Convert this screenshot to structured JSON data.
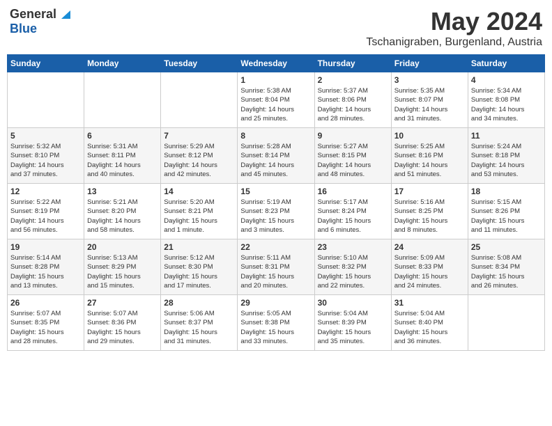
{
  "logo": {
    "general": "General",
    "blue": "Blue"
  },
  "title": {
    "month": "May 2024",
    "location": "Tschanigraben, Burgenland, Austria"
  },
  "weekdays": [
    "Sunday",
    "Monday",
    "Tuesday",
    "Wednesday",
    "Thursday",
    "Friday",
    "Saturday"
  ],
  "weeks": [
    [
      {
        "day": "",
        "info": ""
      },
      {
        "day": "",
        "info": ""
      },
      {
        "day": "",
        "info": ""
      },
      {
        "day": "1",
        "info": "Sunrise: 5:38 AM\nSunset: 8:04 PM\nDaylight: 14 hours\nand 25 minutes."
      },
      {
        "day": "2",
        "info": "Sunrise: 5:37 AM\nSunset: 8:06 PM\nDaylight: 14 hours\nand 28 minutes."
      },
      {
        "day": "3",
        "info": "Sunrise: 5:35 AM\nSunset: 8:07 PM\nDaylight: 14 hours\nand 31 minutes."
      },
      {
        "day": "4",
        "info": "Sunrise: 5:34 AM\nSunset: 8:08 PM\nDaylight: 14 hours\nand 34 minutes."
      }
    ],
    [
      {
        "day": "5",
        "info": "Sunrise: 5:32 AM\nSunset: 8:10 PM\nDaylight: 14 hours\nand 37 minutes."
      },
      {
        "day": "6",
        "info": "Sunrise: 5:31 AM\nSunset: 8:11 PM\nDaylight: 14 hours\nand 40 minutes."
      },
      {
        "day": "7",
        "info": "Sunrise: 5:29 AM\nSunset: 8:12 PM\nDaylight: 14 hours\nand 42 minutes."
      },
      {
        "day": "8",
        "info": "Sunrise: 5:28 AM\nSunset: 8:14 PM\nDaylight: 14 hours\nand 45 minutes."
      },
      {
        "day": "9",
        "info": "Sunrise: 5:27 AM\nSunset: 8:15 PM\nDaylight: 14 hours\nand 48 minutes."
      },
      {
        "day": "10",
        "info": "Sunrise: 5:25 AM\nSunset: 8:16 PM\nDaylight: 14 hours\nand 51 minutes."
      },
      {
        "day": "11",
        "info": "Sunrise: 5:24 AM\nSunset: 8:18 PM\nDaylight: 14 hours\nand 53 minutes."
      }
    ],
    [
      {
        "day": "12",
        "info": "Sunrise: 5:22 AM\nSunset: 8:19 PM\nDaylight: 14 hours\nand 56 minutes."
      },
      {
        "day": "13",
        "info": "Sunrise: 5:21 AM\nSunset: 8:20 PM\nDaylight: 14 hours\nand 58 minutes."
      },
      {
        "day": "14",
        "info": "Sunrise: 5:20 AM\nSunset: 8:21 PM\nDaylight: 15 hours\nand 1 minute."
      },
      {
        "day": "15",
        "info": "Sunrise: 5:19 AM\nSunset: 8:23 PM\nDaylight: 15 hours\nand 3 minutes."
      },
      {
        "day": "16",
        "info": "Sunrise: 5:17 AM\nSunset: 8:24 PM\nDaylight: 15 hours\nand 6 minutes."
      },
      {
        "day": "17",
        "info": "Sunrise: 5:16 AM\nSunset: 8:25 PM\nDaylight: 15 hours\nand 8 minutes."
      },
      {
        "day": "18",
        "info": "Sunrise: 5:15 AM\nSunset: 8:26 PM\nDaylight: 15 hours\nand 11 minutes."
      }
    ],
    [
      {
        "day": "19",
        "info": "Sunrise: 5:14 AM\nSunset: 8:28 PM\nDaylight: 15 hours\nand 13 minutes."
      },
      {
        "day": "20",
        "info": "Sunrise: 5:13 AM\nSunset: 8:29 PM\nDaylight: 15 hours\nand 15 minutes."
      },
      {
        "day": "21",
        "info": "Sunrise: 5:12 AM\nSunset: 8:30 PM\nDaylight: 15 hours\nand 17 minutes."
      },
      {
        "day": "22",
        "info": "Sunrise: 5:11 AM\nSunset: 8:31 PM\nDaylight: 15 hours\nand 20 minutes."
      },
      {
        "day": "23",
        "info": "Sunrise: 5:10 AM\nSunset: 8:32 PM\nDaylight: 15 hours\nand 22 minutes."
      },
      {
        "day": "24",
        "info": "Sunrise: 5:09 AM\nSunset: 8:33 PM\nDaylight: 15 hours\nand 24 minutes."
      },
      {
        "day": "25",
        "info": "Sunrise: 5:08 AM\nSunset: 8:34 PM\nDaylight: 15 hours\nand 26 minutes."
      }
    ],
    [
      {
        "day": "26",
        "info": "Sunrise: 5:07 AM\nSunset: 8:35 PM\nDaylight: 15 hours\nand 28 minutes."
      },
      {
        "day": "27",
        "info": "Sunrise: 5:07 AM\nSunset: 8:36 PM\nDaylight: 15 hours\nand 29 minutes."
      },
      {
        "day": "28",
        "info": "Sunrise: 5:06 AM\nSunset: 8:37 PM\nDaylight: 15 hours\nand 31 minutes."
      },
      {
        "day": "29",
        "info": "Sunrise: 5:05 AM\nSunset: 8:38 PM\nDaylight: 15 hours\nand 33 minutes."
      },
      {
        "day": "30",
        "info": "Sunrise: 5:04 AM\nSunset: 8:39 PM\nDaylight: 15 hours\nand 35 minutes."
      },
      {
        "day": "31",
        "info": "Sunrise: 5:04 AM\nSunset: 8:40 PM\nDaylight: 15 hours\nand 36 minutes."
      },
      {
        "day": "",
        "info": ""
      }
    ]
  ]
}
